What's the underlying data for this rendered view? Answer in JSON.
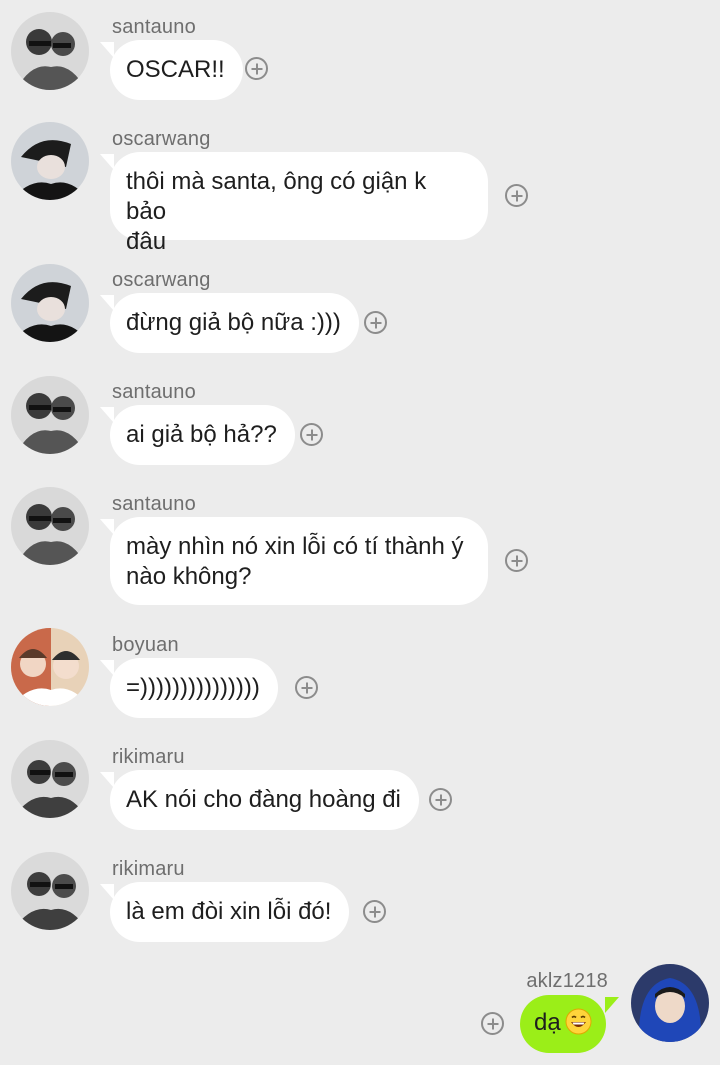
{
  "messages": [
    {
      "sender": "santauno",
      "text": "OSCAR!!",
      "avatar_icon": "santauno-avatar"
    },
    {
      "sender": "oscarwang",
      "text": "thôi mà santa, ông có giận k bảo\nđâu",
      "avatar_icon": "oscarwang-avatar"
    },
    {
      "sender": "oscarwang",
      "text": "đừng giả bộ nữa :)))",
      "avatar_icon": "oscarwang-avatar"
    },
    {
      "sender": "santauno",
      "text": "ai giả bộ hả??",
      "avatar_icon": "santauno-avatar"
    },
    {
      "sender": "santauno",
      "text": "mày nhìn nó xin lỗi có tí thành ý\nnào không?",
      "avatar_icon": "santauno-avatar"
    },
    {
      "sender": "boyuan",
      "text": "=)))))))))))))))",
      "avatar_icon": "boyuan-avatar"
    },
    {
      "sender": "rikimaru",
      "text": "AK nói cho đàng hoàng đi",
      "avatar_icon": "rikimaru-avatar"
    },
    {
      "sender": "rikimaru",
      "text": "là em đòi xin lỗi đó!",
      "avatar_icon": "rikimaru-avatar"
    }
  ],
  "own_message": {
    "sender": "aklz1218",
    "text": "dạ",
    "emoji": "grinning-face-emoji",
    "avatar_icon": "aklz1218-avatar"
  },
  "colors": {
    "background": "#ececec",
    "bubble_other": "#ffffff",
    "bubble_own": "#9bee18",
    "sender_name": "#6e6e6e"
  }
}
